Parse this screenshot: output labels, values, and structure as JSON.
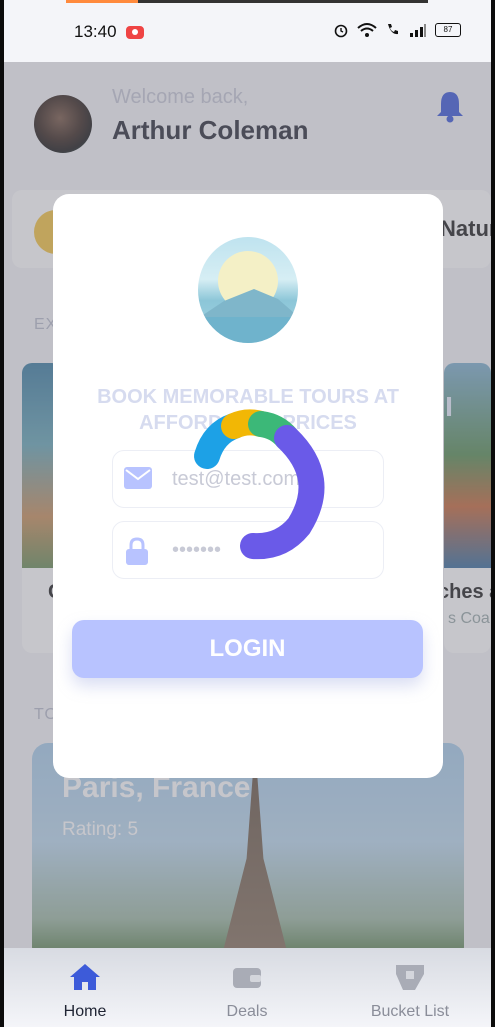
{
  "status_bar": {
    "time": "13:40",
    "battery": "87"
  },
  "header": {
    "welcome": "Welcome back,",
    "user_name": "Arthur Coleman"
  },
  "background": {
    "category_partial": "Nature",
    "section_explore_partial": "EX",
    "section_top_partial": "TO",
    "tour_left_partial": "C",
    "tour_right_title_partial": "a, I",
    "tour_right_name_partial": "ches a",
    "tour_right_sub_partial": "s Coa",
    "featured_title": "Paris, France",
    "featured_rating": "Rating: 5"
  },
  "modal": {
    "tagline_line1": "BOOK MEMORABLE TOURS AT",
    "tagline_line2": "AFFORDABLE PRICES",
    "email_value": "test@test.com",
    "password_value": "•••••••",
    "login_label": "LOGIN"
  },
  "loading_spinner": {
    "colors": [
      "#1da1e6",
      "#f2b705",
      "#3cb878",
      "#6a5ae8"
    ]
  },
  "bottom_nav": {
    "items": [
      {
        "label": "Home",
        "active": true
      },
      {
        "label": "Deals",
        "active": false
      },
      {
        "label": "Bucket List",
        "active": false
      }
    ]
  },
  "colors": {
    "accent": "#3d5bd9",
    "login_button": "#b8c3ff"
  }
}
